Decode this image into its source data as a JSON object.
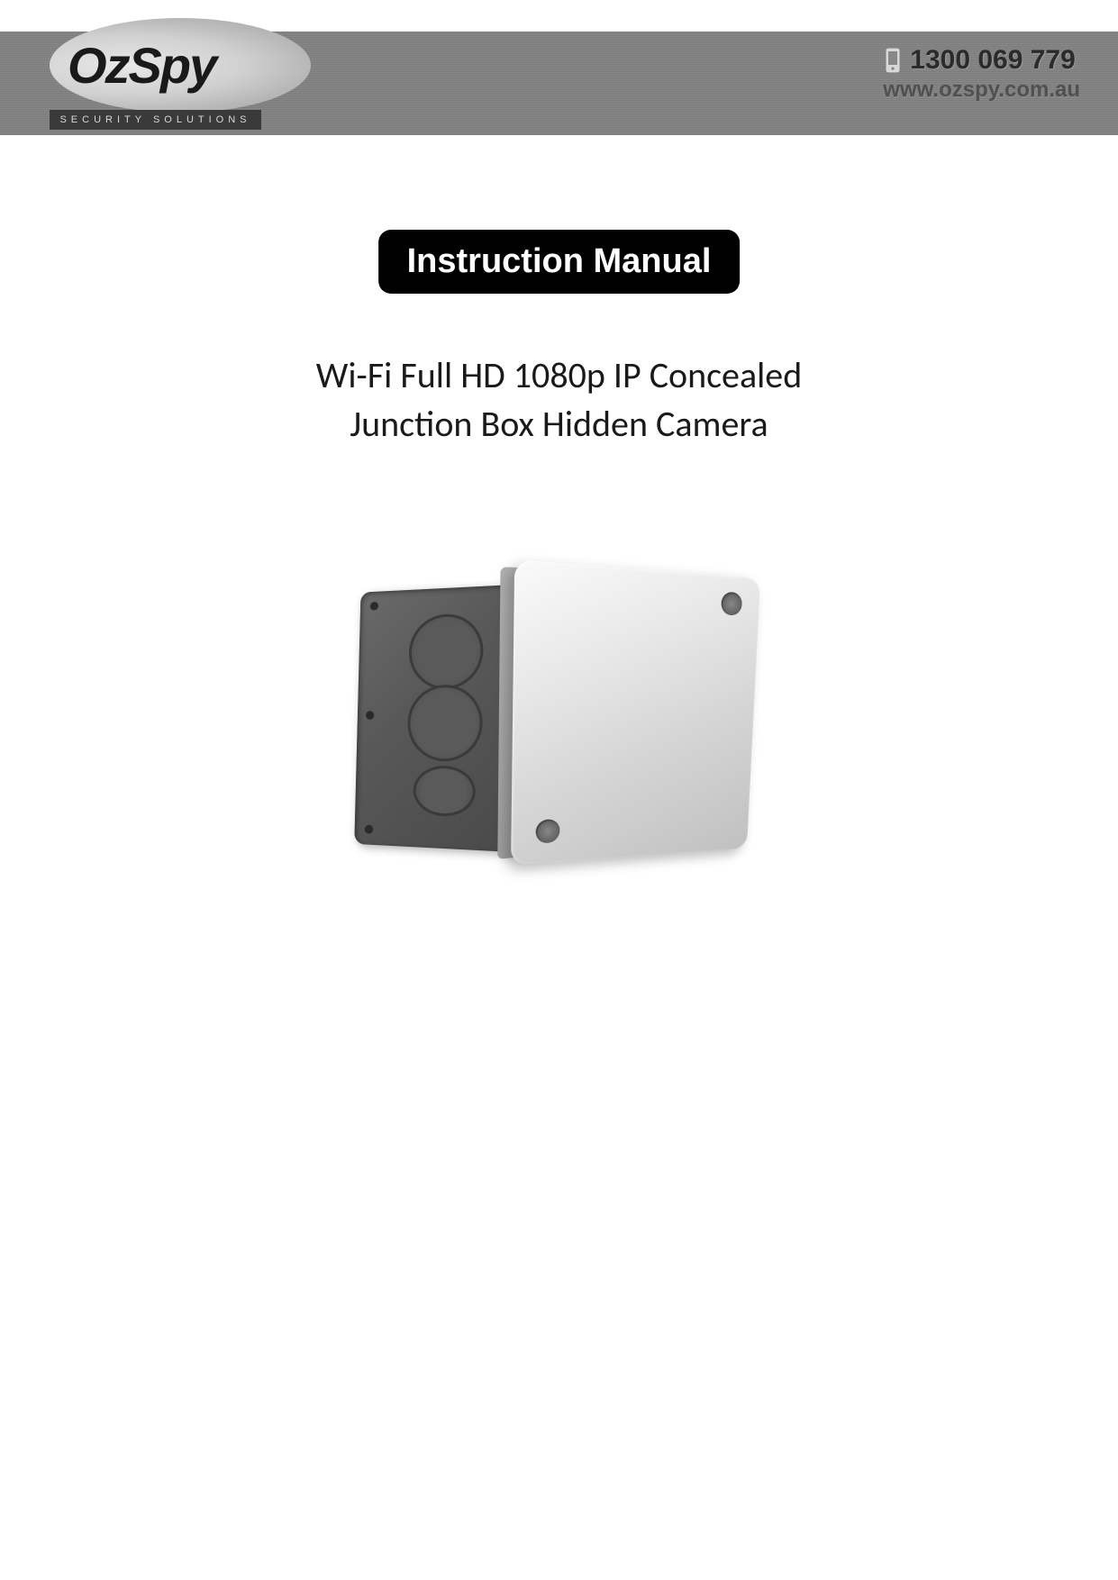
{
  "header": {
    "logo_text": "OzSpy",
    "logo_tagline": "SECURITY SOLUTIONS",
    "phone": "1300 069 779",
    "website": "www.ozspy.com.au"
  },
  "badge": {
    "label": "Instruction Manual"
  },
  "product": {
    "title_line1": "Wi-Fi Full HD 1080p IP Concealed",
    "title_line2": "Junction Box Hidden Camera"
  }
}
